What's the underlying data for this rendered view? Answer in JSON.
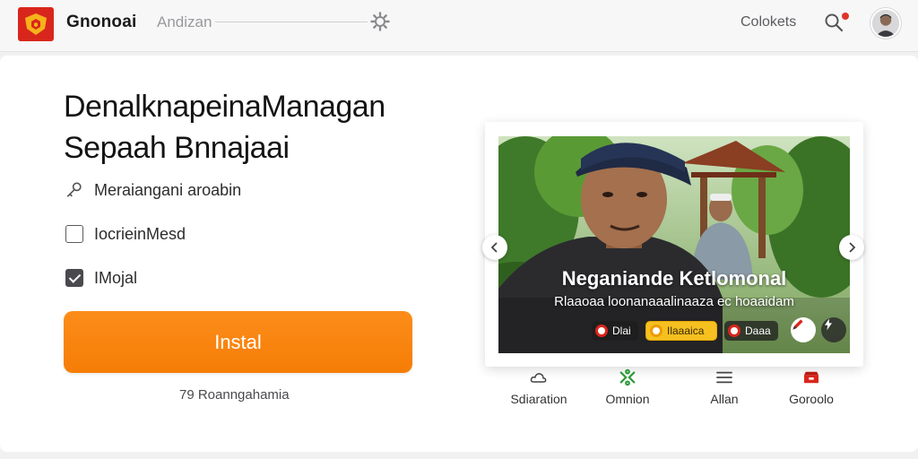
{
  "header": {
    "brand": "Gnonoai",
    "nav_link": "Andizan",
    "contacts_label": "Colokets"
  },
  "hero": {
    "headline_line1": "DenalknapeinaManagan",
    "headline_line2": "Sepaah Bnnajaai",
    "options": [
      {
        "label": "Meraiangani aroabin",
        "icon": "key-icon",
        "checked": null
      },
      {
        "label": "IocrieinMesd",
        "icon": "checkbox",
        "checked": false
      },
      {
        "label": "IMojal",
        "icon": "checkbox",
        "checked": true
      }
    ],
    "install_label": "Instal",
    "rating_text": "79 Roanngahamia"
  },
  "media": {
    "overlay_title": "Neganiande Ketlomonal",
    "overlay_subtitle": "Rlaaoaa loonanaaalinaaza ec hoaaidam",
    "chips": [
      {
        "label": "Dlai",
        "icon": "record-icon"
      },
      {
        "label": "Ilaaaica",
        "icon": "record-icon"
      },
      {
        "label": "Daaa",
        "icon": "record-icon"
      }
    ]
  },
  "tabs": [
    {
      "label": "Sdiaration",
      "icon": "cloud-icon"
    },
    {
      "label": "Omnion",
      "icon": "network-icon"
    },
    {
      "label": "Allan",
      "icon": "menu-icon"
    },
    {
      "label": "Goroolo",
      "icon": "inbox-icon"
    }
  ],
  "colors": {
    "accent": "#f57d06",
    "brand_red": "#d9261c",
    "notification": "#e0342a"
  }
}
